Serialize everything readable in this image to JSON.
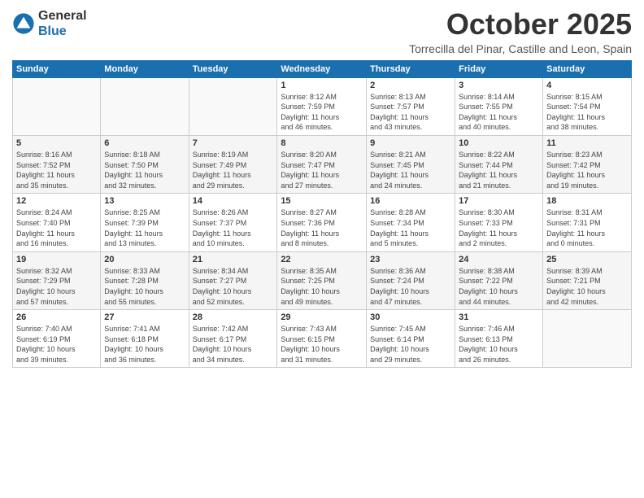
{
  "header": {
    "logo_general": "General",
    "logo_blue": "Blue",
    "month_title": "October 2025",
    "location": "Torrecilla del Pinar, Castille and Leon, Spain"
  },
  "weekdays": [
    "Sunday",
    "Monday",
    "Tuesday",
    "Wednesday",
    "Thursday",
    "Friday",
    "Saturday"
  ],
  "weeks": [
    [
      {
        "day": "",
        "info": ""
      },
      {
        "day": "",
        "info": ""
      },
      {
        "day": "",
        "info": ""
      },
      {
        "day": "1",
        "info": "Sunrise: 8:12 AM\nSunset: 7:59 PM\nDaylight: 11 hours\nand 46 minutes."
      },
      {
        "day": "2",
        "info": "Sunrise: 8:13 AM\nSunset: 7:57 PM\nDaylight: 11 hours\nand 43 minutes."
      },
      {
        "day": "3",
        "info": "Sunrise: 8:14 AM\nSunset: 7:55 PM\nDaylight: 11 hours\nand 40 minutes."
      },
      {
        "day": "4",
        "info": "Sunrise: 8:15 AM\nSunset: 7:54 PM\nDaylight: 11 hours\nand 38 minutes."
      }
    ],
    [
      {
        "day": "5",
        "info": "Sunrise: 8:16 AM\nSunset: 7:52 PM\nDaylight: 11 hours\nand 35 minutes."
      },
      {
        "day": "6",
        "info": "Sunrise: 8:18 AM\nSunset: 7:50 PM\nDaylight: 11 hours\nand 32 minutes."
      },
      {
        "day": "7",
        "info": "Sunrise: 8:19 AM\nSunset: 7:49 PM\nDaylight: 11 hours\nand 29 minutes."
      },
      {
        "day": "8",
        "info": "Sunrise: 8:20 AM\nSunset: 7:47 PM\nDaylight: 11 hours\nand 27 minutes."
      },
      {
        "day": "9",
        "info": "Sunrise: 8:21 AM\nSunset: 7:45 PM\nDaylight: 11 hours\nand 24 minutes."
      },
      {
        "day": "10",
        "info": "Sunrise: 8:22 AM\nSunset: 7:44 PM\nDaylight: 11 hours\nand 21 minutes."
      },
      {
        "day": "11",
        "info": "Sunrise: 8:23 AM\nSunset: 7:42 PM\nDaylight: 11 hours\nand 19 minutes."
      }
    ],
    [
      {
        "day": "12",
        "info": "Sunrise: 8:24 AM\nSunset: 7:40 PM\nDaylight: 11 hours\nand 16 minutes."
      },
      {
        "day": "13",
        "info": "Sunrise: 8:25 AM\nSunset: 7:39 PM\nDaylight: 11 hours\nand 13 minutes."
      },
      {
        "day": "14",
        "info": "Sunrise: 8:26 AM\nSunset: 7:37 PM\nDaylight: 11 hours\nand 10 minutes."
      },
      {
        "day": "15",
        "info": "Sunrise: 8:27 AM\nSunset: 7:36 PM\nDaylight: 11 hours\nand 8 minutes."
      },
      {
        "day": "16",
        "info": "Sunrise: 8:28 AM\nSunset: 7:34 PM\nDaylight: 11 hours\nand 5 minutes."
      },
      {
        "day": "17",
        "info": "Sunrise: 8:30 AM\nSunset: 7:33 PM\nDaylight: 11 hours\nand 2 minutes."
      },
      {
        "day": "18",
        "info": "Sunrise: 8:31 AM\nSunset: 7:31 PM\nDaylight: 11 hours\nand 0 minutes."
      }
    ],
    [
      {
        "day": "19",
        "info": "Sunrise: 8:32 AM\nSunset: 7:29 PM\nDaylight: 10 hours\nand 57 minutes."
      },
      {
        "day": "20",
        "info": "Sunrise: 8:33 AM\nSunset: 7:28 PM\nDaylight: 10 hours\nand 55 minutes."
      },
      {
        "day": "21",
        "info": "Sunrise: 8:34 AM\nSunset: 7:27 PM\nDaylight: 10 hours\nand 52 minutes."
      },
      {
        "day": "22",
        "info": "Sunrise: 8:35 AM\nSunset: 7:25 PM\nDaylight: 10 hours\nand 49 minutes."
      },
      {
        "day": "23",
        "info": "Sunrise: 8:36 AM\nSunset: 7:24 PM\nDaylight: 10 hours\nand 47 minutes."
      },
      {
        "day": "24",
        "info": "Sunrise: 8:38 AM\nSunset: 7:22 PM\nDaylight: 10 hours\nand 44 minutes."
      },
      {
        "day": "25",
        "info": "Sunrise: 8:39 AM\nSunset: 7:21 PM\nDaylight: 10 hours\nand 42 minutes."
      }
    ],
    [
      {
        "day": "26",
        "info": "Sunrise: 7:40 AM\nSunset: 6:19 PM\nDaylight: 10 hours\nand 39 minutes."
      },
      {
        "day": "27",
        "info": "Sunrise: 7:41 AM\nSunset: 6:18 PM\nDaylight: 10 hours\nand 36 minutes."
      },
      {
        "day": "28",
        "info": "Sunrise: 7:42 AM\nSunset: 6:17 PM\nDaylight: 10 hours\nand 34 minutes."
      },
      {
        "day": "29",
        "info": "Sunrise: 7:43 AM\nSunset: 6:15 PM\nDaylight: 10 hours\nand 31 minutes."
      },
      {
        "day": "30",
        "info": "Sunrise: 7:45 AM\nSunset: 6:14 PM\nDaylight: 10 hours\nand 29 minutes."
      },
      {
        "day": "31",
        "info": "Sunrise: 7:46 AM\nSunset: 6:13 PM\nDaylight: 10 hours\nand 26 minutes."
      },
      {
        "day": "",
        "info": ""
      }
    ]
  ]
}
